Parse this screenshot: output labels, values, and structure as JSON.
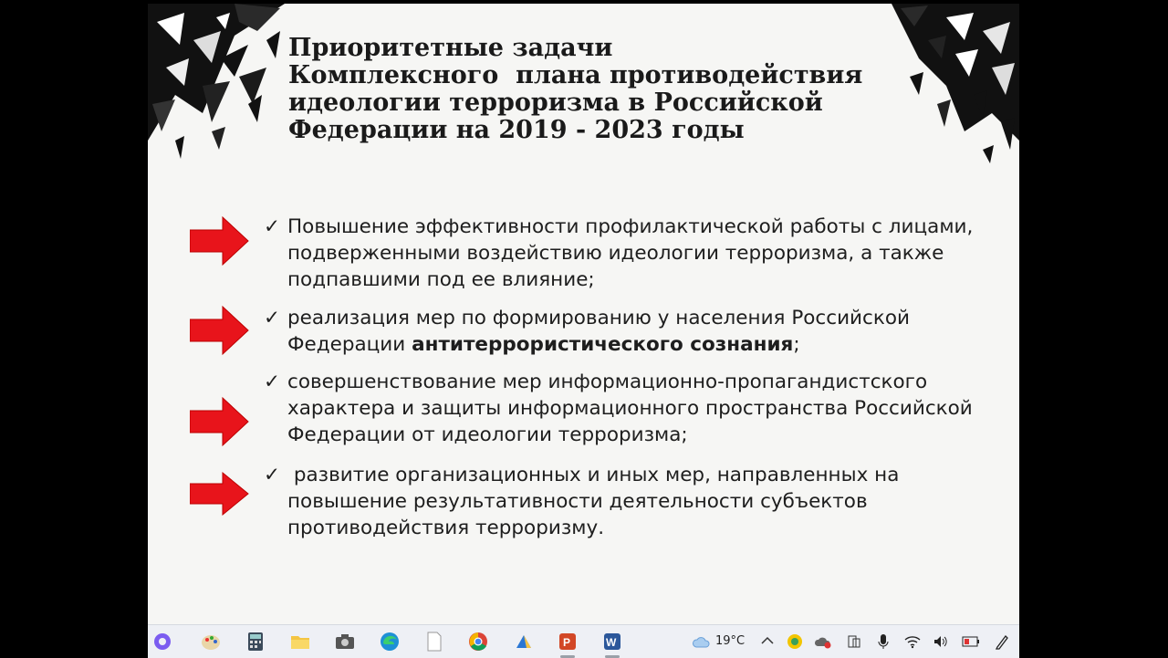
{
  "slide": {
    "title_lines": [
      "Приоритетные задачи",
      "Комплексного  плана противодействия",
      "идеологии терроризма в Российской",
      "Федерации на 2019 - 2023 годы"
    ],
    "check_mark": "✓",
    "bullets": [
      {
        "text": "Повышение эффективности профилактической работы с лицами, подверженными воздействию идеологии терроризма, а также подпавшими под ее влияние;"
      },
      {
        "text_before": "реализация мер по формированию у населения Российской Федерации ",
        "text_bold": "антитеррористического сознания",
        "text_after": ";"
      },
      {
        "text": "совершенствование мер информационно-пропагандистского характера и защиты информационного пространства Российской Федерации от идеологии терроризма;"
      },
      {
        "text": " развитие организационных и иных мер, направленных на повышение результативности деятельности субъектов противодействия терроризму."
      }
    ],
    "arrow_color": "#e8141b"
  },
  "taskbar": {
    "apps": [
      "cortana-icon",
      "paint-icon",
      "calculator-icon",
      "file-explorer-icon",
      "camera-icon",
      "edge-icon",
      "notepad-icon",
      "chrome-icon",
      "onedrive-icon",
      "powerpoint-icon",
      "word-icon"
    ],
    "temperature": "19°C",
    "tray": [
      "chevron-up-icon",
      "app-tray-icon",
      "cloud-sync-icon",
      "taskview-icon",
      "mic-icon",
      "wifi-icon",
      "volume-icon",
      "battery-icon",
      "pen-icon"
    ]
  }
}
